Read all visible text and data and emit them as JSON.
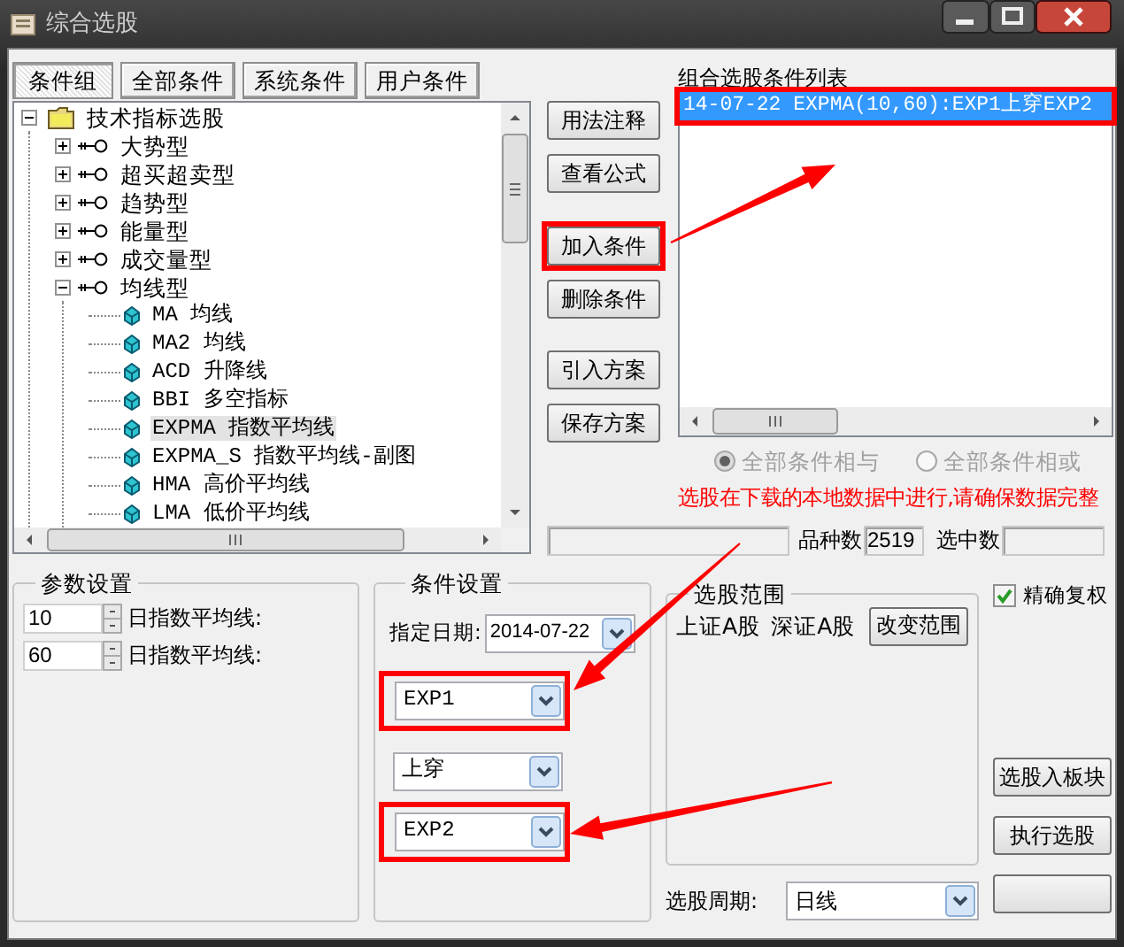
{
  "window": {
    "title": "综合选股"
  },
  "tabs": [
    {
      "label": "条件组",
      "selected": true
    },
    {
      "label": "全部条件",
      "selected": false
    },
    {
      "label": "系统条件",
      "selected": false
    },
    {
      "label": "用户条件",
      "selected": false
    }
  ],
  "tree": [
    {
      "label": "技术指标选股",
      "kind": "folder",
      "expanded": true,
      "children": [
        {
          "label": "大势型",
          "kind": "group",
          "expanded": false
        },
        {
          "label": "超买超卖型",
          "kind": "group",
          "expanded": false
        },
        {
          "label": "趋势型",
          "kind": "group",
          "expanded": false
        },
        {
          "label": "能量型",
          "kind": "group",
          "expanded": false
        },
        {
          "label": "成交量型",
          "kind": "group",
          "expanded": false
        },
        {
          "label": "均线型",
          "kind": "group",
          "expanded": true,
          "children": [
            {
              "label": "MA 均线",
              "kind": "indicator",
              "selected": false
            },
            {
              "label": "MA2 均线",
              "kind": "indicator",
              "selected": false
            },
            {
              "label": "ACD 升降线",
              "kind": "indicator",
              "selected": false
            },
            {
              "label": "BBI 多空指标",
              "kind": "indicator",
              "selected": false
            },
            {
              "label": "EXPMA 指数平均线",
              "kind": "indicator",
              "selected": true
            },
            {
              "label": "EXPMA_S 指数平均线-副图",
              "kind": "indicator",
              "selected": false
            },
            {
              "label": "HMA 高价平均线",
              "kind": "indicator",
              "selected": false
            },
            {
              "label": "LMA 低价平均线",
              "kind": "indicator",
              "selected": false
            }
          ]
        }
      ]
    }
  ],
  "side_buttons": [
    [
      {
        "label": "用法注释",
        "highlighted": false
      },
      {
        "label": "查看公式",
        "highlighted": false
      }
    ],
    [
      {
        "label": "加入条件",
        "highlighted": true
      },
      {
        "label": "删除条件",
        "highlighted": false
      }
    ],
    [
      {
        "label": "引入方案",
        "highlighted": false
      },
      {
        "label": "保存方案",
        "highlighted": false
      }
    ]
  ],
  "condition_list": {
    "title": "组合选股条件列表",
    "items": [
      {
        "text": "14-07-22 EXPMA(10,60):EXP1上穿EXP2",
        "selected": true,
        "highlighted": true
      }
    ]
  },
  "logic": {
    "disabled": true,
    "options": [
      {
        "label": "全部条件相与",
        "selected": true
      },
      {
        "label": "全部条件相或",
        "selected": false
      }
    ]
  },
  "notice": "选股在下载的本地数据中进行,请确保数据完整",
  "status": {
    "count_label": "品种数",
    "count": "2519",
    "selected_label": "选中数"
  },
  "params": {
    "title": "参数设置",
    "rows": [
      {
        "value": "10",
        "label": "日指数平均线:"
      },
      {
        "value": "60",
        "label": "日指数平均线:"
      }
    ]
  },
  "condition_settings": {
    "title": "条件设置",
    "date_label": "指定日期:",
    "date": "2014-07-22",
    "combos": [
      {
        "value": "EXP1",
        "highlighted": true
      },
      {
        "value": "上穿",
        "highlighted": false
      },
      {
        "value": "EXP2",
        "highlighted": true
      }
    ]
  },
  "scope": {
    "title": "选股范围",
    "markets": [
      "上证A股",
      "深证A股"
    ],
    "button": "改变范围"
  },
  "exact_adjust": {
    "label": "精确复权",
    "checked": true
  },
  "action_buttons": [
    "选股入板块",
    "执行选股"
  ],
  "period": {
    "label": "选股周期:",
    "value": "日线"
  }
}
